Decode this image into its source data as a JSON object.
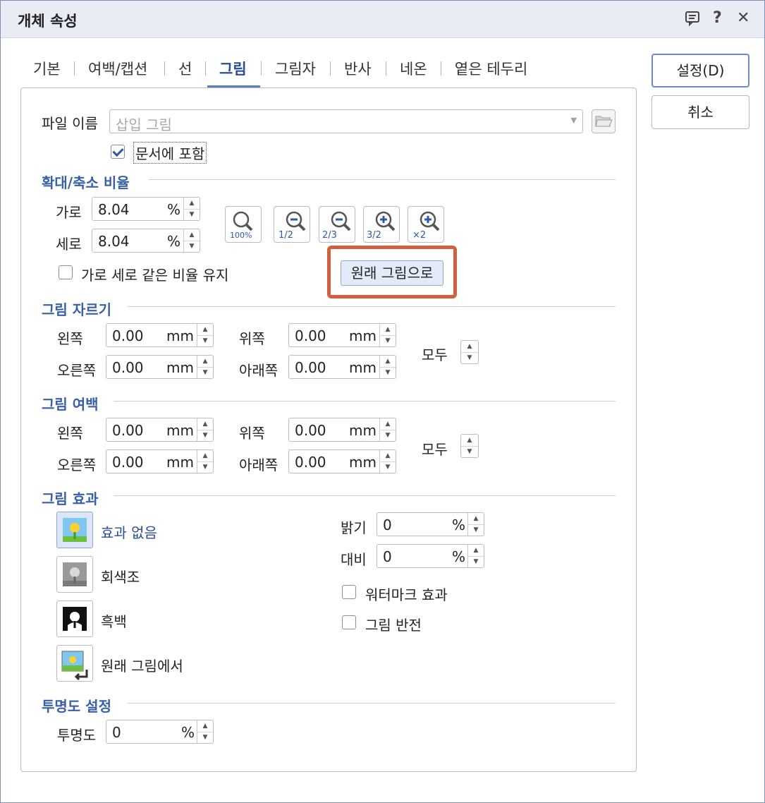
{
  "window": {
    "title": "개체 속성"
  },
  "titlebar": {
    "help": "?",
    "close": "✕"
  },
  "tabs": [
    "기본",
    "여백/캡션",
    "선",
    "그림",
    "그림자",
    "반사",
    "네온",
    "옅은 테두리"
  ],
  "active_tab": "그림",
  "buttons": {
    "ok": "설정(D)",
    "cancel": "취소"
  },
  "file": {
    "label": "파일 이름",
    "placeholder": "삽입 그림",
    "include_label": "문서에 포함",
    "include_checked": true
  },
  "scale": {
    "section": "확대/축소 비율",
    "width_label": "가로",
    "width_value": "8.04",
    "width_unit": "%",
    "height_label": "세로",
    "height_value": "8.04",
    "height_unit": "%",
    "keep_ratio_label": "가로 세로 같은 비율 유지",
    "zoom_buttons": [
      "100%",
      "1/2",
      "2/3",
      "3/2",
      "×2"
    ],
    "original_button": "원래 그림으로"
  },
  "crop": {
    "section": "그림 자르기",
    "left_label": "왼쪽",
    "left": "0.00",
    "top_label": "위쪽",
    "top": "0.00",
    "right_label": "오른쪽",
    "right": "0.00",
    "bottom_label": "아래쪽",
    "bottom": "0.00",
    "unit": "mm",
    "all_label": "모두"
  },
  "margin": {
    "section": "그림 여백",
    "left_label": "왼쪽",
    "left": "0.00",
    "top_label": "위쪽",
    "top": "0.00",
    "right_label": "오른쪽",
    "right": "0.00",
    "bottom_label": "아래쪽",
    "bottom": "0.00",
    "unit": "mm",
    "all_label": "모두"
  },
  "effect": {
    "section": "그림 효과",
    "options": [
      "효과 없음",
      "회색조",
      "흑백",
      "원래 그림에서"
    ],
    "selected": "효과 없음",
    "brightness_label": "밝기",
    "brightness": "0",
    "brightness_unit": "%",
    "contrast_label": "대비",
    "contrast": "0",
    "contrast_unit": "%",
    "watermark_label": "워터마크 효과",
    "invert_label": "그림 반전"
  },
  "transparency": {
    "section": "투명도 설정",
    "label": "투명도",
    "value": "0",
    "unit": "%"
  },
  "colors": {
    "accent": "#3760a8",
    "highlight": "#d2603e",
    "titlebar": "#e9ecf5"
  }
}
